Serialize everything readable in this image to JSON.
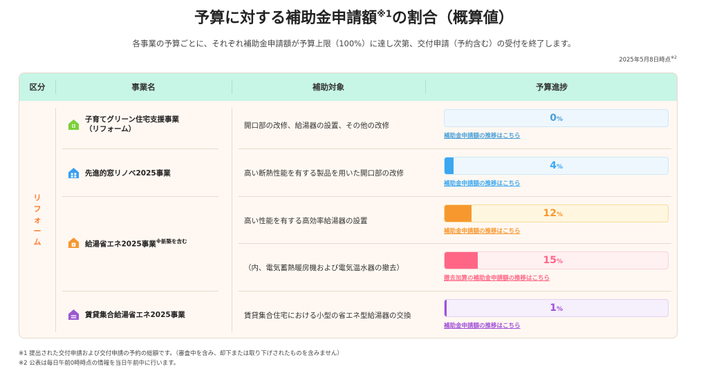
{
  "header": {
    "title": "予算に対する補助金申請額",
    "title_sup": "※1",
    "title_tail": "の割合（概算値）",
    "subtitle": "各事業の予算ごとに、それぞれ補助金申請額が予算上限（100%）に達し次第、交付申請（予約含む）の受付を終了します。",
    "as_of": "2025年5月8日時点",
    "as_of_sup": "※2"
  },
  "table": {
    "headers": [
      "区分",
      "事業名",
      "補助対象",
      "予算進捗"
    ],
    "category": [
      "リ",
      "フ",
      "ォ",
      "ー",
      "ム"
    ],
    "businesses": [
      {
        "name_line1": "子育てグリーン住宅支援事業",
        "name_line2": "（リフォーム）",
        "icon": "green-house-icon",
        "color": "#7ccf3b"
      },
      {
        "name_line1": "先進的窓リノベ2025事業",
        "icon": "window-house-icon",
        "color": "#3b9ff0"
      },
      {
        "name_line1": "給湯省エネ2025事業",
        "sup": "※新築を含む",
        "icon": "water-heater-house-icon",
        "color": "#f7982f"
      },
      {
        "name_line1": "賃貸集合給湯省エネ2025事業",
        "icon": "rental-house-icon",
        "color": "#9b59d0"
      }
    ],
    "rows": [
      {
        "target": "開口部の改修、給湯器の設置、その他の改修",
        "percent": 0,
        "percent_label": "0",
        "unit": "%",
        "link": "補助金申請額の推移はこちら",
        "color": "#4a9fd8",
        "bg": "#eef7fd",
        "border": "#cfe7f7"
      },
      {
        "target": "高い断熱性能を有する製品を用いた開口部の改修",
        "percent": 4,
        "percent_label": "4",
        "unit": "%",
        "link": "補助金申請額の推移はこちら",
        "color": "#3ba7f0",
        "bg": "#eef7fd",
        "border": "#cfe7f7"
      },
      {
        "target": "高い性能を有する高効率給湯器の設置",
        "percent": 12,
        "percent_label": "12",
        "unit": "%",
        "link": "補助金申請額の推移はこちら",
        "color": "#f7982f",
        "bg": "#fff6e0",
        "border": "#f6dc9a"
      },
      {
        "target": "（内、電気蓄熱暖房機および電気温水器の撤去）",
        "percent": 15,
        "percent_label": "15",
        "unit": "%",
        "link": "撤去加算の補助金申請額の推移はこちら",
        "color": "#ff6685",
        "bg": "#fff0f2",
        "border": "#f8d3da"
      },
      {
        "target": "賃貸集合住宅における小型の省エネ型給湯器の交換",
        "percent": 1,
        "percent_label": "1",
        "unit": "%",
        "link": "補助金申請額の推移はこちら",
        "color": "#a050d8",
        "bg": "#f6effc",
        "border": "#e2d0f2"
      }
    ]
  },
  "notes": [
    "※1 提出された交付申請および交付申請の予約の総額です。（審査中を含み、却下または取り下げされたものを含みません）",
    "※2 公表は毎日午前0時時点の情報を当日午前中に行います。"
  ]
}
